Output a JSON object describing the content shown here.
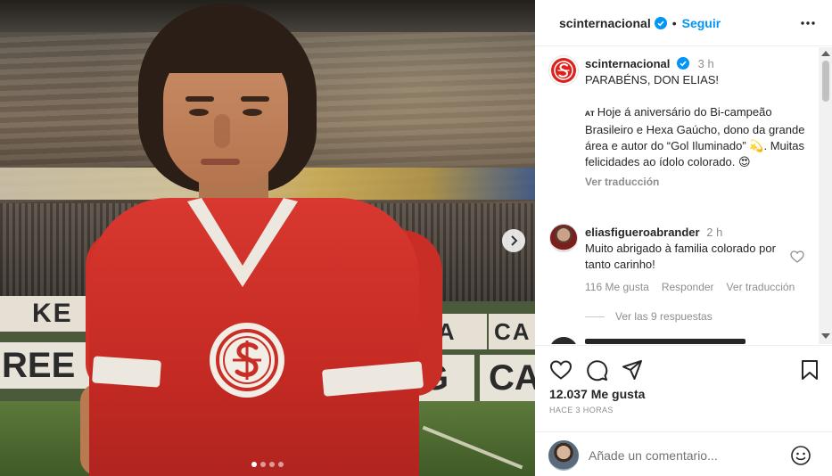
{
  "post": {
    "header_user": "scinternacional",
    "follow_label": "Seguir",
    "separator": "•"
  },
  "caption": {
    "user": "scinternacional",
    "time": "3 h",
    "title": "PARABÉNS, DON ELIAS!",
    "body_1": "Hoje á aniversário do Bi-campeão Brasileiro e Hexa Gaúcho, dono da grande área e autor do “Gol Iluminado”",
    "body_2": ". Muitas felicidades ao ídolo colorado.",
    "translate": "Ver traducción"
  },
  "comment": {
    "user": "eliasfigueroabrander",
    "time": "2 h",
    "text": "Muito abrigado à familia colorado por tanto carinho!",
    "likes": "116 Me gusta",
    "reply": "Responder",
    "translate": "Ver traducción",
    "replies": "Ver las 9 respuestas"
  },
  "footer": {
    "likes": "12.037 Me gusta",
    "ago": "HACE 3 HORAS",
    "comment_placeholder": "Añade un comentario..."
  },
  "photo": {
    "carousel_count": 4,
    "carousel_active": 1,
    "boards": [
      "KE",
      "REE",
      "G",
      "CA",
      "NA",
      "CA"
    ]
  },
  "colors": {
    "brand_red": "#e0201b",
    "link_blue": "#0095f6",
    "muted": "#8e8e8e"
  }
}
